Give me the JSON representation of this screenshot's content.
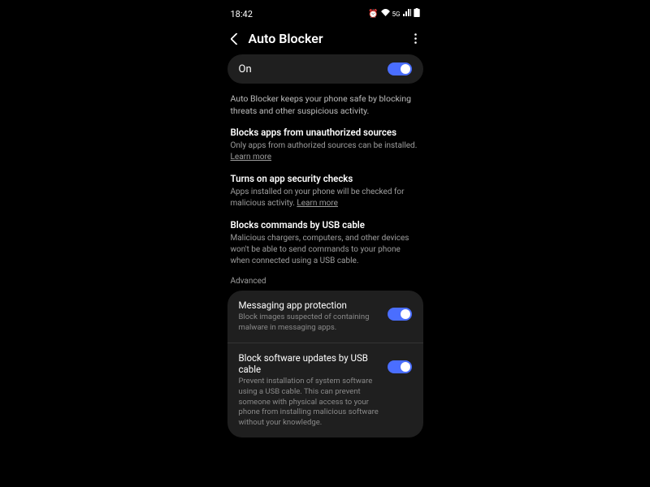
{
  "status_bar": {
    "time": "18:42",
    "icons": [
      "⏰",
      "📶",
      "5G",
      "📶",
      "🔋"
    ]
  },
  "header": {
    "title": "Auto Blocker"
  },
  "main_toggle": {
    "label": "On",
    "state": "true"
  },
  "intro": "Auto Blocker keeps your phone safe by blocking threats and other suspicious activity.",
  "sections": [
    {
      "title": "Blocks apps from unauthorized sources",
      "desc": "Only apps from authorized sources can be installed.",
      "learn_more": "Learn more"
    },
    {
      "title": "Turns on app security checks",
      "desc": "Apps installed on your phone will be checked for malicious activity. ",
      "learn_more": "Learn more"
    },
    {
      "title": "Blocks commands by USB cable",
      "desc": "Malicious chargers, computers, and other devices won't be able to send commands to your phone when connected using a USB cable."
    }
  ],
  "advanced_label": "Advanced",
  "advanced_items": [
    {
      "title": "Messaging app protection",
      "desc": "Block images suspected of containing malware in messaging apps.",
      "state": "true"
    },
    {
      "title": "Block software updates by USB cable",
      "desc": "Prevent installation of system software using a USB cable. This can prevent someone with physical access to your phone from installing malicious software without your knowledge.",
      "state": "true"
    }
  ]
}
